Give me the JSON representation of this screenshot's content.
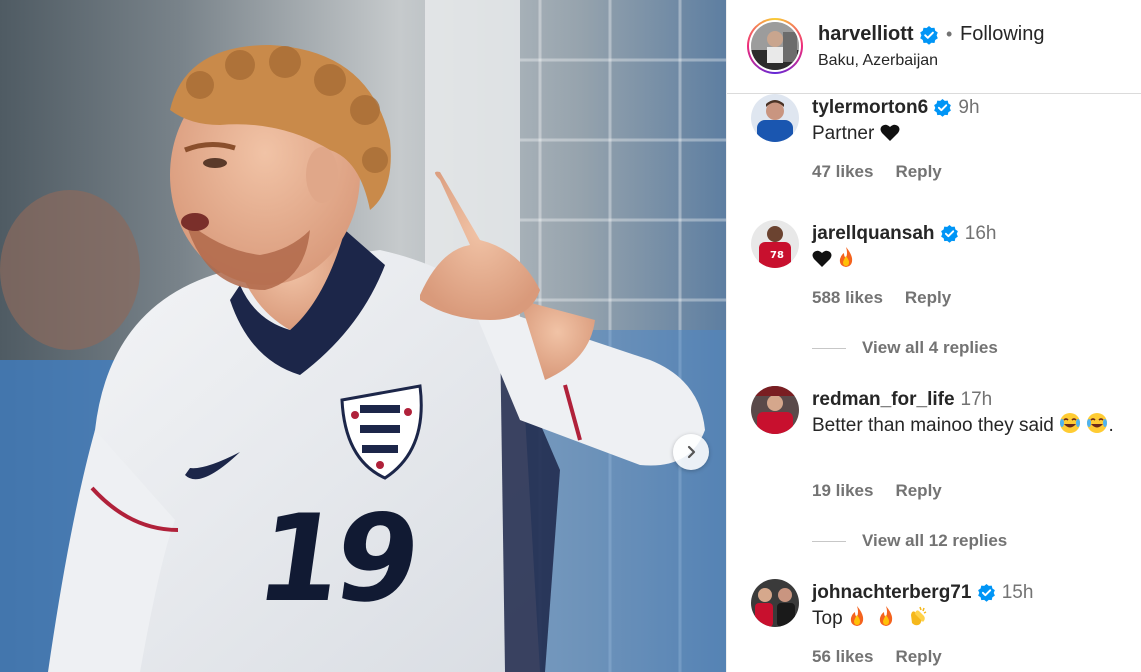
{
  "post": {
    "image_alt": "Harvey Elliott in England #19 shirt",
    "shirt_number": "19",
    "next_icon": "chevron-right-icon"
  },
  "header": {
    "username": "harvelliott",
    "verified": true,
    "separator": "•",
    "follow_status": "Following",
    "location": "Baku, Azerbaijan"
  },
  "comments": [
    {
      "username": "tylermorton6",
      "verified": true,
      "time": "9h",
      "text": "Partner",
      "emojis": [
        "black-heart"
      ],
      "likes": "47 likes",
      "reply": "Reply"
    },
    {
      "username": "jarellquansah",
      "verified": true,
      "time": "16h",
      "text": "",
      "emojis": [
        "black-heart",
        "fire"
      ],
      "likes": "588 likes",
      "reply": "Reply",
      "view_replies": "View all 4 replies"
    },
    {
      "username": "redman_for_life",
      "verified": false,
      "time": "17h",
      "text": "Better than mainoo they said",
      "text_end": ".",
      "emojis": [
        "joy",
        "joy"
      ],
      "likes": "19 likes",
      "reply": "Reply",
      "view_replies": "View all 12 replies"
    },
    {
      "username": "johnachterberg71",
      "verified": true,
      "time": "15h",
      "text": "Top",
      "emojis": [
        "fire",
        "fire",
        "clap"
      ],
      "likes": "56 likes",
      "reply": "Reply"
    }
  ],
  "colors": {
    "verified_blue": "#0095f6",
    "secondary_text": "#737373",
    "primary_text": "#262626"
  }
}
